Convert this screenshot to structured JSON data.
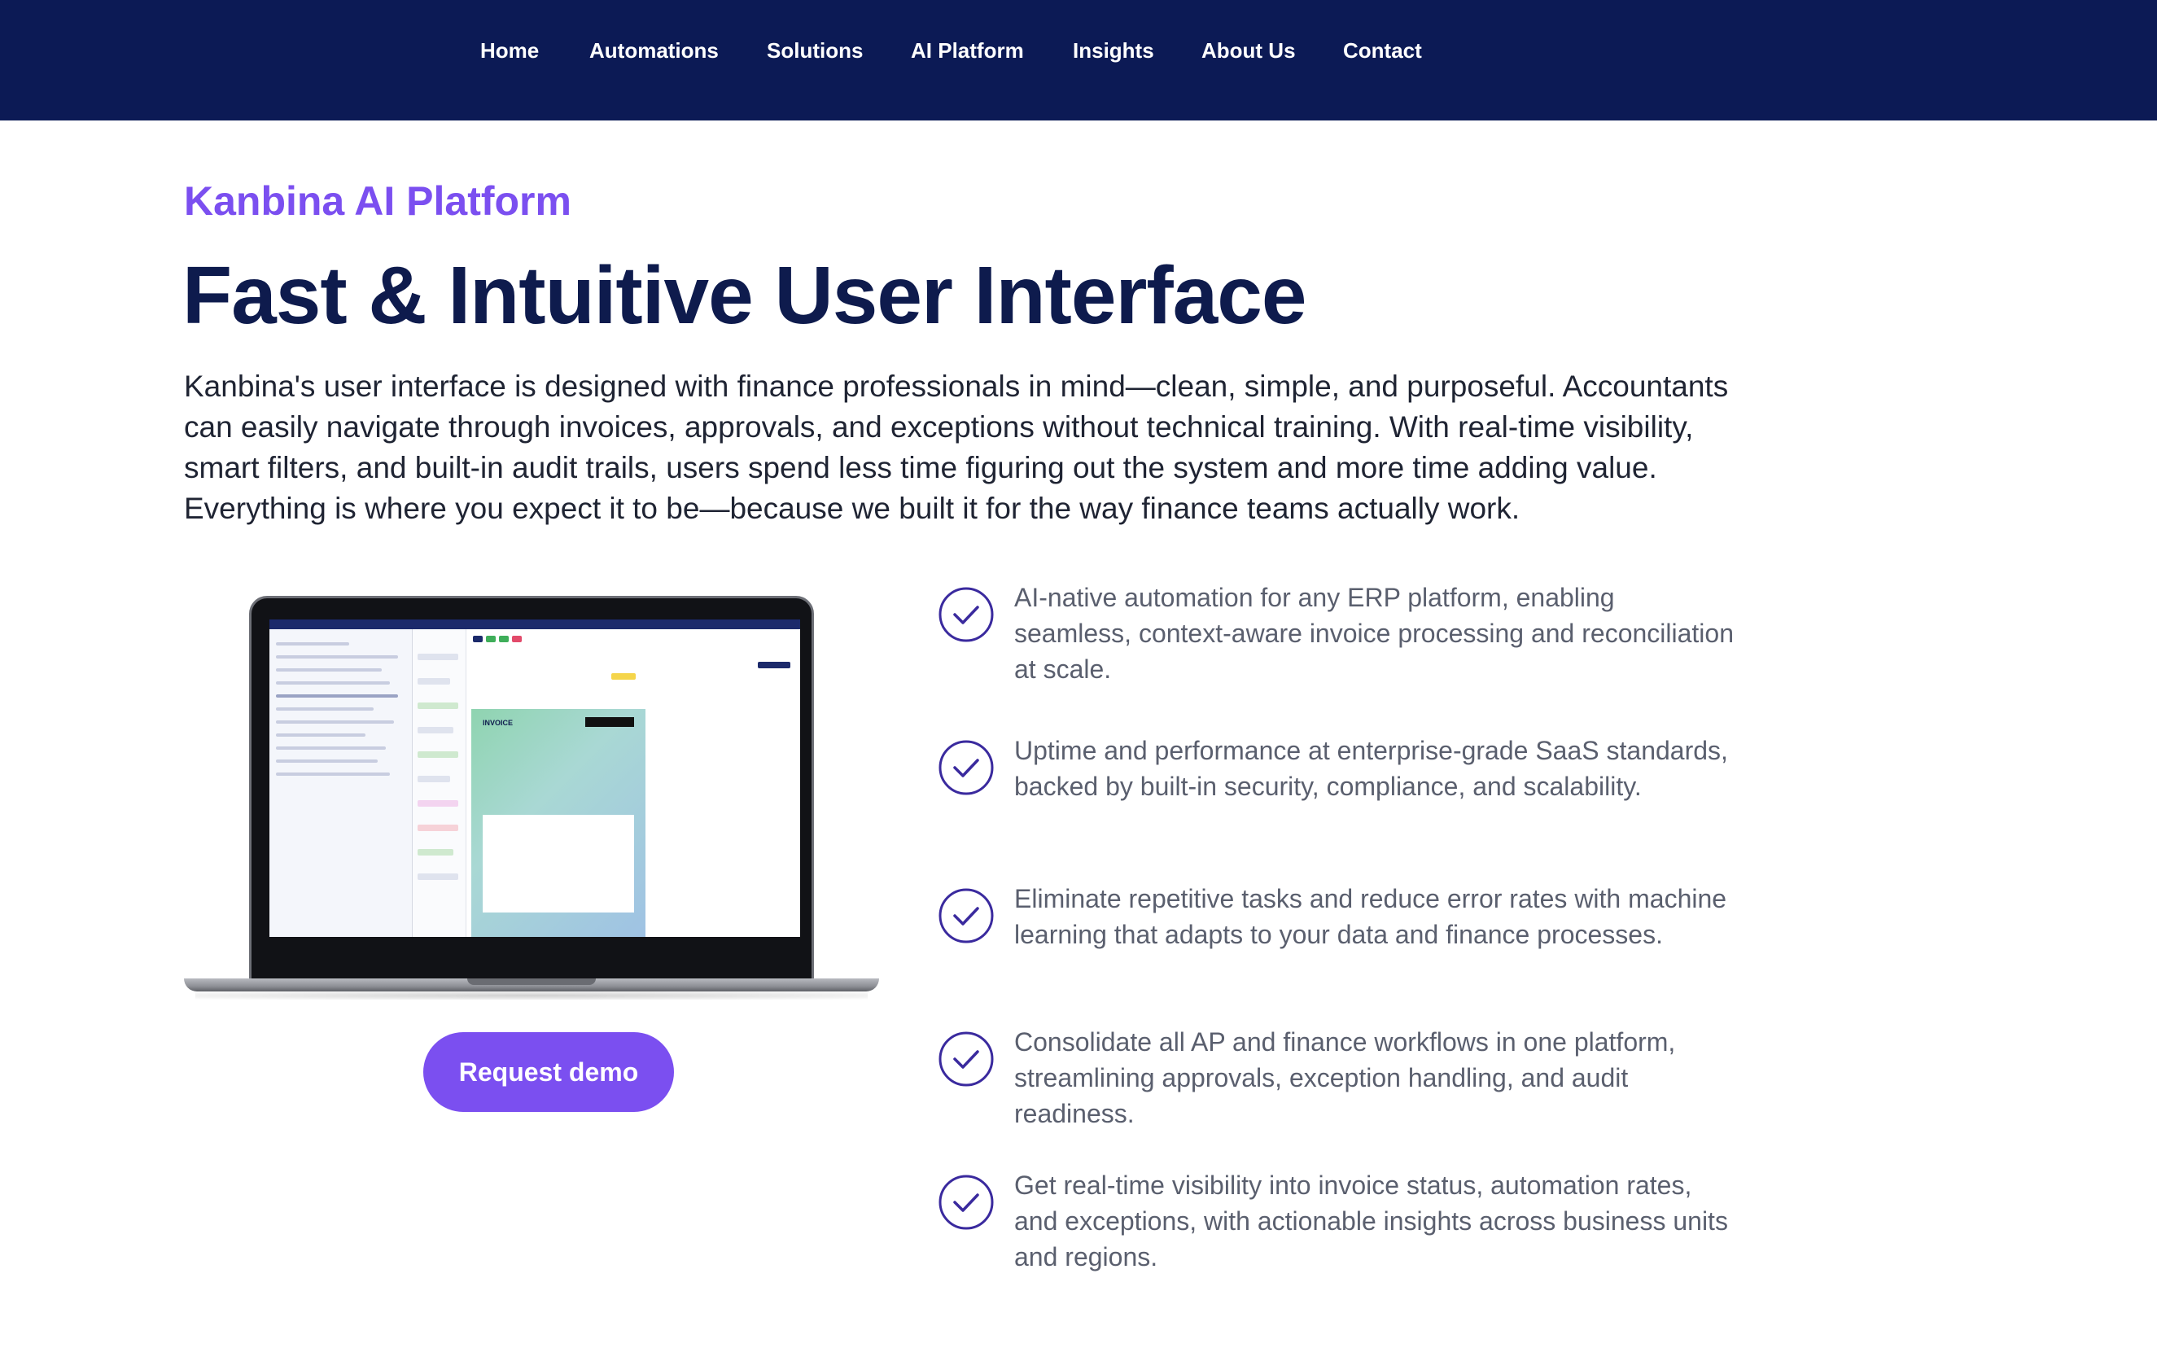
{
  "nav": {
    "items": [
      {
        "label": "Home"
      },
      {
        "label": "Automations"
      },
      {
        "label": "Solutions"
      },
      {
        "label": "AI Platform"
      },
      {
        "label": "Insights"
      },
      {
        "label": "About Us"
      },
      {
        "label": "Contact"
      }
    ]
  },
  "hero": {
    "eyebrow": "Kanbina AI Platform",
    "title": "Fast & Intuitive User Interface",
    "intro": "Kanbina's user interface is designed with finance professionals in mind—clean, simple, and purposeful. Accountants can easily navigate through invoices, approvals, and exceptions without technical training. With real-time visibility, smart filters, and built-in audit trails, users spend less time figuring out the system and more time adding value. Everything is where you expect it to be—because we built it for the way finance teams actually work."
  },
  "screenshot": {
    "invoice_label": "INVOICE"
  },
  "cta": {
    "label": "Request demo"
  },
  "features": [
    {
      "text": "AI-native automation for any ERP platform, enabling seamless, context-aware invoice processing and reconciliation at scale."
    },
    {
      "text": "Uptime and performance at enterprise-grade SaaS standards, backed by built-in security, compliance, and scalability."
    },
    {
      "text": "Eliminate repetitive tasks and reduce error rates with machine learning that adapts to your data and finance processes."
    },
    {
      "text": "Consolidate all AP and finance workflows in one platform, streamlining approvals, exception handling, and audit readiness."
    },
    {
      "text": "Get real-time visibility into invoice status, automation rates, and exceptions, with actionable insights across business units and regions."
    }
  ],
  "colors": {
    "nav_bg": "#0c1a55",
    "accent": "#7b4ff0",
    "heading": "#0e1b4d",
    "check": "#3a2a9e"
  },
  "icons": {
    "check": "check-circle-icon"
  }
}
